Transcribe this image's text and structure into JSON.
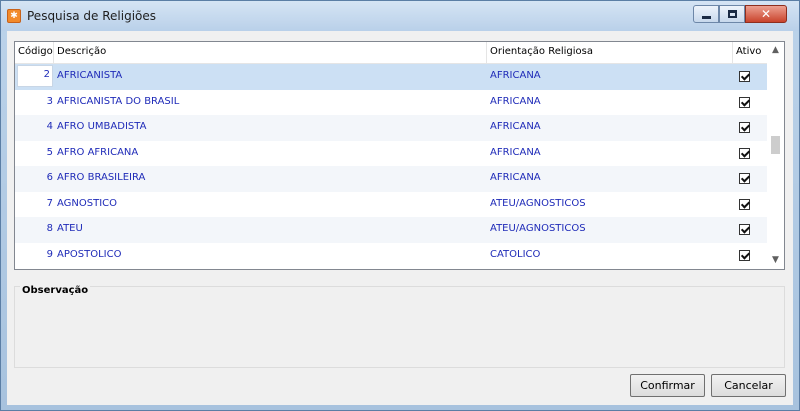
{
  "window": {
    "title": "Pesquisa de Religiões",
    "icon": "app-logo-icon"
  },
  "grid": {
    "columns": [
      "Código",
      "Descrição",
      "Orientação Religiosa",
      "Ativo"
    ],
    "editing_value": "2",
    "rows": [
      {
        "code": "",
        "descricao": "AFRICANISTA",
        "orientacao": "AFRICANA",
        "ativo": true
      },
      {
        "code": "3",
        "descricao": "AFRICANISTA DO BRASIL",
        "orientacao": "AFRICANA",
        "ativo": true
      },
      {
        "code": "4",
        "descricao": "AFRO UMBADISTA",
        "orientacao": "AFRICANA",
        "ativo": true
      },
      {
        "code": "5",
        "descricao": "AFRO AFRICANA",
        "orientacao": "AFRICANA",
        "ativo": true
      },
      {
        "code": "6",
        "descricao": "AFRO BRASILEIRA",
        "orientacao": "AFRICANA",
        "ativo": true
      },
      {
        "code": "7",
        "descricao": "AGNOSTICO",
        "orientacao": "ATEU/AGNOSTICOS",
        "ativo": true
      },
      {
        "code": "8",
        "descricao": "ATEU",
        "orientacao": "ATEU/AGNOSTICOS",
        "ativo": true
      },
      {
        "code": "9",
        "descricao": "APOSTOLICO",
        "orientacao": "CATOLICO",
        "ativo": true
      }
    ]
  },
  "observacao": {
    "label": "Observação",
    "value": ""
  },
  "buttons": {
    "confirm": "Confirmar",
    "cancel": "Cancelar"
  },
  "colors": {
    "cell_text": "#1f2bb8",
    "selected_row": "#cce0f4",
    "alt_row": "#f3f6fa"
  }
}
